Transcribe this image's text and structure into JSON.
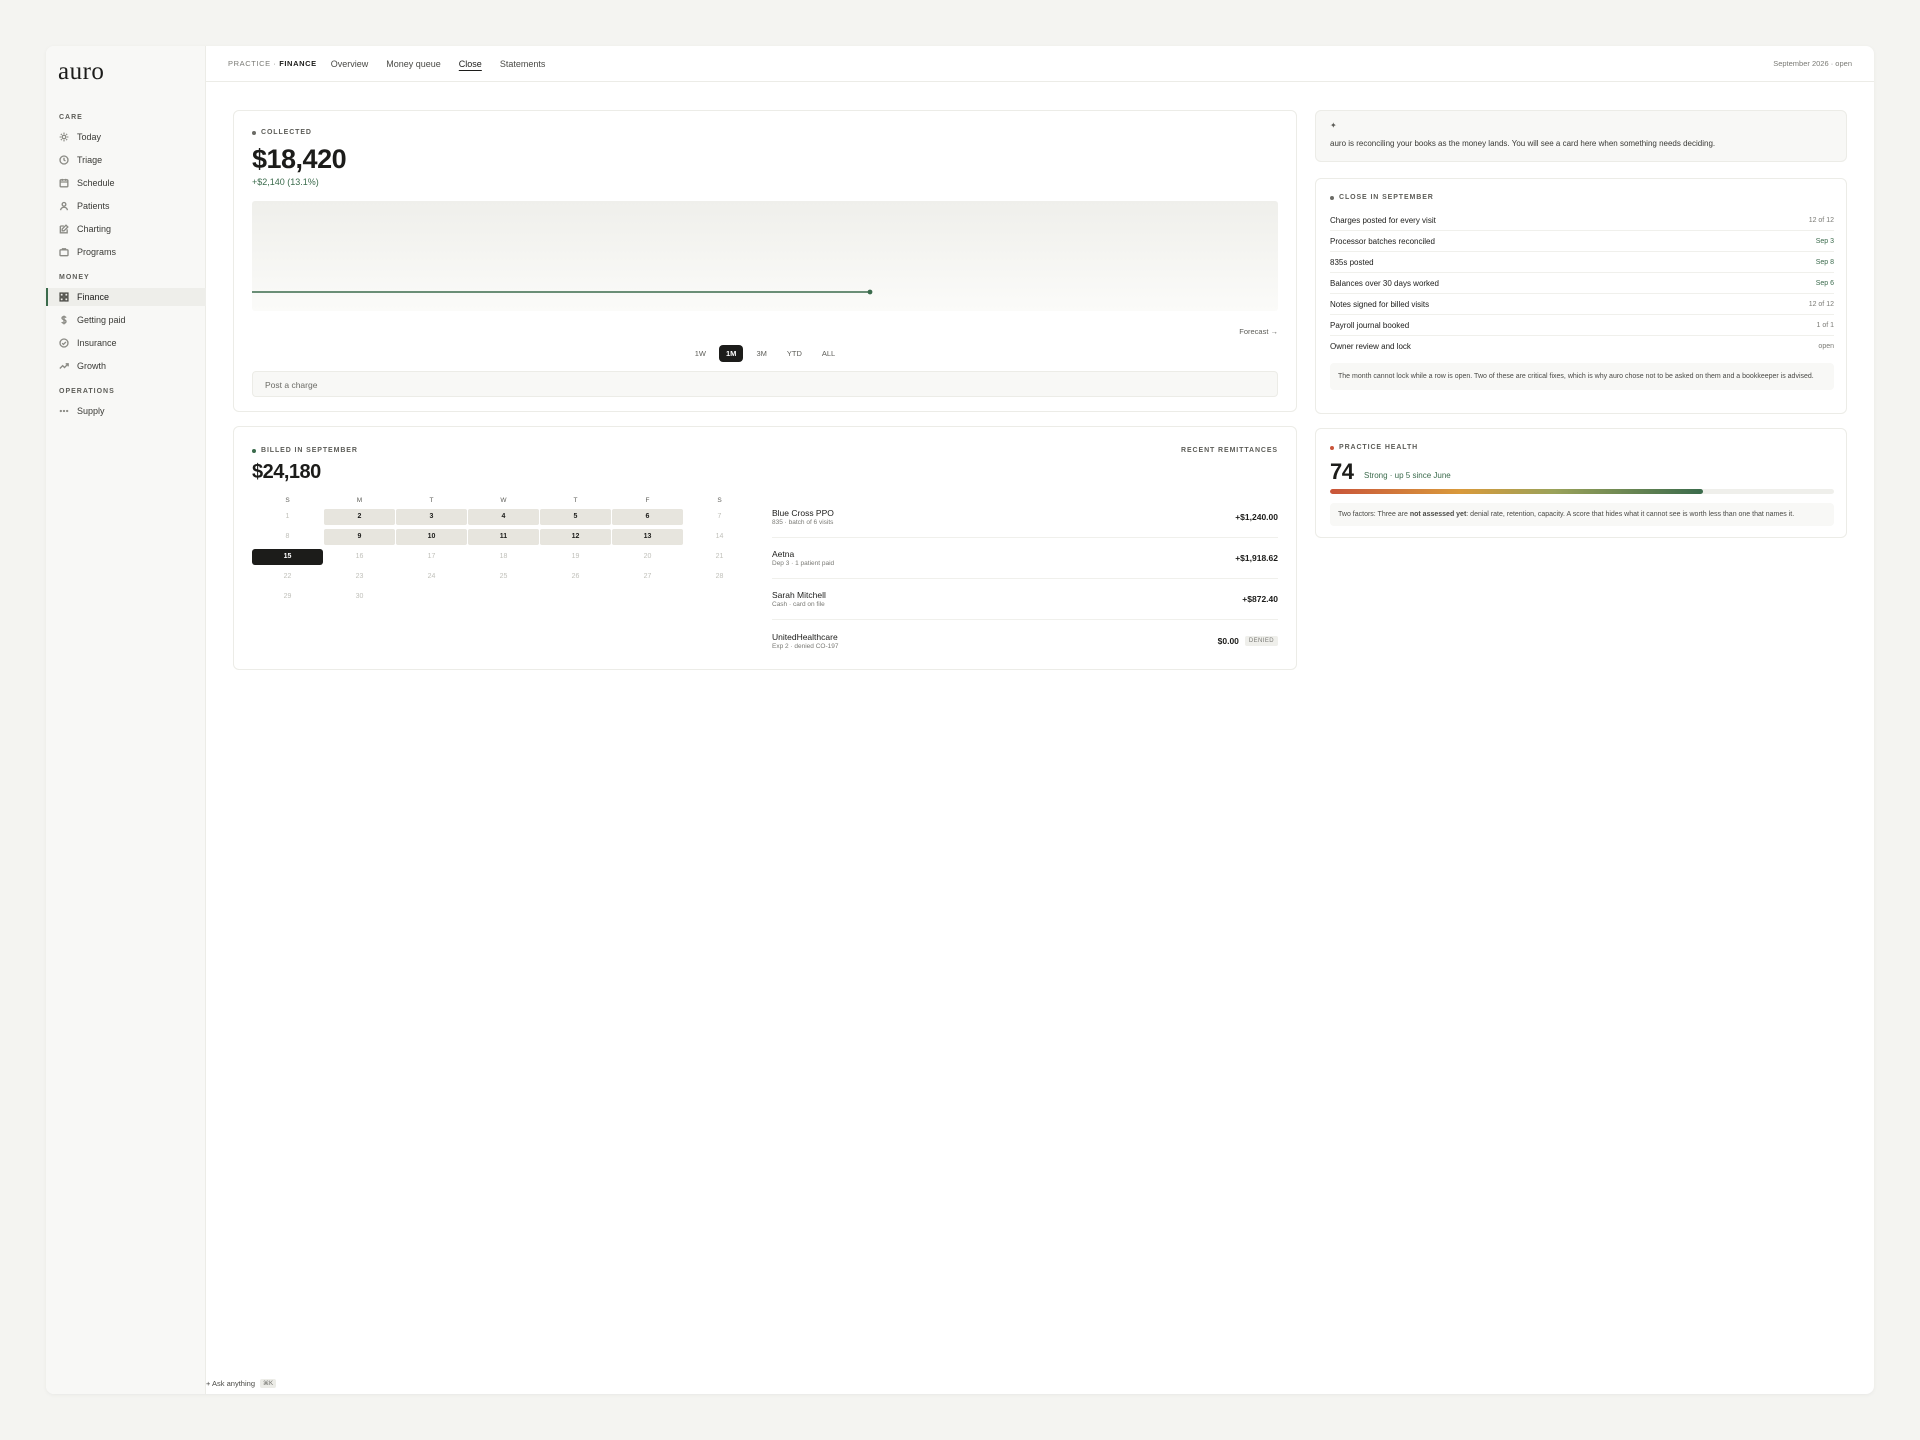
{
  "app": {
    "logo": "auro"
  },
  "sidebar": {
    "sections": [
      {
        "label": "CARE"
      },
      {
        "label": "MONEY"
      },
      {
        "label": "OPERATIONS"
      }
    ],
    "items": [
      {
        "label": "Today",
        "icon": "sun-icon"
      },
      {
        "label": "Triage",
        "icon": "clock-icon"
      },
      {
        "label": "Schedule",
        "icon": "calendar-icon"
      },
      {
        "label": "Patients",
        "icon": "user-icon"
      },
      {
        "label": "Charting",
        "icon": "edit-icon"
      },
      {
        "label": "Programs",
        "icon": "briefcase-icon"
      },
      {
        "label": "Finance",
        "icon": "grid-icon",
        "active": true
      },
      {
        "label": "Getting paid",
        "icon": "dollar-icon"
      },
      {
        "label": "Insurance",
        "icon": "check-circle-icon"
      },
      {
        "label": "Growth",
        "icon": "trend-up-icon"
      },
      {
        "label": "Supply",
        "icon": "more-icon"
      }
    ]
  },
  "topbar": {
    "crumb_prefix": "PRACTICE · ",
    "crumb_current": "FINANCE",
    "tabs": [
      {
        "label": "Overview"
      },
      {
        "label": "Money queue"
      },
      {
        "label": "Close",
        "active": true
      },
      {
        "label": "Statements"
      }
    ],
    "status": "September 2026 · open"
  },
  "collected": {
    "eyebrow": "COLLECTED",
    "amount": "$18,420",
    "delta": "+$2,140 (13.1%)",
    "forecast": "Forecast →",
    "ranges": [
      "1W",
      "1M",
      "3M",
      "YTD",
      "ALL"
    ],
    "active_range": "1M",
    "post_placeholder": "Post a charge",
    "colors": {
      "line": "#3b6b4c"
    }
  },
  "billed": {
    "eyebrow": "BILLED IN SEPTEMBER",
    "amount": "$24,180",
    "weekdays": [
      "S",
      "M",
      "T",
      "W",
      "T",
      "F",
      "S"
    ],
    "days": [
      [
        "1",
        "",
        ""
      ],
      [
        "2",
        "busy",
        ""
      ],
      [
        "3",
        "busy",
        ""
      ],
      [
        "4",
        "busy",
        ""
      ],
      [
        "5",
        "busy",
        ""
      ],
      [
        "6",
        "busy",
        ""
      ],
      [
        "7",
        "",
        ""
      ],
      [
        "8",
        "",
        ""
      ],
      [
        "9",
        "busy",
        ""
      ],
      [
        "10",
        "busy",
        ""
      ],
      [
        "11",
        "busy",
        ""
      ],
      [
        "12",
        "busy",
        ""
      ],
      [
        "13",
        "busy",
        ""
      ],
      [
        "14",
        "",
        ""
      ],
      [
        "15",
        "today",
        ""
      ],
      [
        "16",
        "",
        ""
      ],
      [
        "17",
        "",
        ""
      ],
      [
        "18",
        "",
        ""
      ],
      [
        "19",
        "",
        ""
      ],
      [
        "20",
        "",
        ""
      ],
      [
        "21",
        "",
        ""
      ],
      [
        "22",
        "",
        ""
      ],
      [
        "23",
        "",
        ""
      ],
      [
        "24",
        "",
        ""
      ],
      [
        "25",
        "",
        ""
      ],
      [
        "26",
        "",
        ""
      ],
      [
        "27",
        "",
        ""
      ],
      [
        "28",
        "",
        ""
      ],
      [
        "29",
        "",
        ""
      ],
      [
        "30",
        "",
        ""
      ]
    ]
  },
  "remittances": {
    "title": "RECENT REMITTANCES",
    "rows": [
      {
        "name": "Blue Cross PPO",
        "sub": "835 · batch of 6 visits",
        "amount": "+$1,240.00",
        "tag": ""
      },
      {
        "name": "Aetna",
        "sub": "Dep 3 · 1 patient paid",
        "amount": "+$1,918.62",
        "tag": ""
      },
      {
        "name": "Sarah Mitchell",
        "sub": "Cash · card on file",
        "amount": "+$872.40",
        "tag": ""
      },
      {
        "name": "UnitedHealthcare",
        "sub": "Exp 2 · denied CO-197",
        "amount": "$0.00",
        "tag": "DENIED"
      }
    ]
  },
  "assistant": {
    "glyph": "✦",
    "message": "auro is reconciling your books as the money lands. You will see a card here when something needs deciding."
  },
  "close": {
    "eyebrow": "CLOSE IN SEPTEMBER",
    "rows": [
      {
        "label": "Charges posted for every visit",
        "value": "12 of 12",
        "done": true
      },
      {
        "label": "Processor batches reconciled",
        "value": "Sep 3",
        "done": true
      },
      {
        "label": "835s posted",
        "value": "Sep 8",
        "done": true
      },
      {
        "label": "Balances over 30 days worked",
        "value": "Sep 6",
        "done": true
      },
      {
        "label": "Notes signed for billed visits",
        "value": "12 of 12",
        "done": true
      },
      {
        "label": "Payroll journal booked",
        "value": "1 of 1",
        "done": false
      },
      {
        "label": "Owner review and lock",
        "value": "open",
        "done": false
      }
    ],
    "note": "The month cannot lock while a row is open. Two of these are critical fixes, which is why auro chose not to be asked on them and a bookkeeper is advised."
  },
  "health": {
    "eyebrow": "PRACTICE HEALTH",
    "score": "74",
    "caption": "Strong · up 5 since June",
    "level": 0.74,
    "note_prefix": "Two factors: Three are ",
    "note_bold": "not assessed yet",
    "note_suffix": ": denial rate, retention, capacity. A score that hides what it cannot see is worth less than one that names it.",
    "colors": {
      "dot": "#c9553a"
    }
  },
  "ask": {
    "label": "+ Ask anything",
    "shortcut": "⌘K"
  }
}
